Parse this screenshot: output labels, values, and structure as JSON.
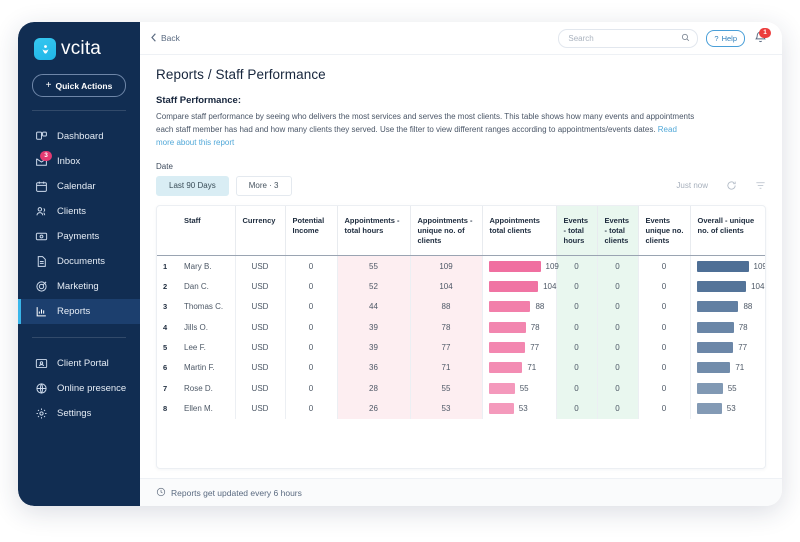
{
  "brand": {
    "name": "vcita",
    "logo_icon": "vcita-logo-icon",
    "accent": "#39b6ea",
    "sidebar_bg": "#112d52"
  },
  "sidebar": {
    "quick_actions": {
      "label": "Quick Actions",
      "icon": "plus-icon"
    },
    "items": [
      {
        "label": "Dashboard",
        "icon": "dashboard-icon",
        "active": false,
        "badge": ""
      },
      {
        "label": "Inbox",
        "icon": "inbox-icon",
        "active": false,
        "badge": "3"
      },
      {
        "label": "Calendar",
        "icon": "calendar-icon",
        "active": false,
        "badge": ""
      },
      {
        "label": "Clients",
        "icon": "clients-icon",
        "active": false,
        "badge": ""
      },
      {
        "label": "Payments",
        "icon": "payments-icon",
        "active": false,
        "badge": ""
      },
      {
        "label": "Documents",
        "icon": "documents-icon",
        "active": false,
        "badge": ""
      },
      {
        "label": "Marketing",
        "icon": "marketing-icon",
        "active": false,
        "badge": ""
      },
      {
        "label": "Reports",
        "icon": "reports-icon",
        "active": true,
        "badge": ""
      }
    ],
    "secondary_items": [
      {
        "label": "Client Portal",
        "icon": "client-portal-icon"
      },
      {
        "label": "Online presence",
        "icon": "globe-icon"
      },
      {
        "label": "Settings",
        "icon": "gear-icon"
      }
    ]
  },
  "topbar": {
    "back_label": "Back",
    "search_placeholder": "Search",
    "search_value": "",
    "help_label": "Help",
    "notifications_count": "1"
  },
  "page": {
    "title": "Reports / Staff Performance",
    "section_title": "Staff Performance:",
    "description": "Compare staff performance by seeing who delivers the most services and serves the most clients. This table shows how many events and appointments each staff member has had and how many clients they served. Use the filter to view different ranges according to appointments/events dates.",
    "read_more_label": "Read more about this report"
  },
  "filters": {
    "date_label": "Date",
    "range_chip": "Last 90 Days",
    "more_chip": "More · 3",
    "updated_label": "Just now",
    "refresh_icon": "refresh-icon",
    "filter_icon": "filter-icon"
  },
  "footer": {
    "icon": "clock-icon",
    "text": "Reports get updated every 6 hours"
  },
  "table": {
    "columns": [
      "Staff",
      "Currency",
      "Potential Income",
      "Appointments - total hours",
      "Appointments - unique no. of clients",
      "Appointments total clients",
      "Events - total hours",
      "Events - total clients",
      "Events unique no. clients",
      "Overall - unique no. of clients"
    ],
    "rows": [
      {
        "idx": "1",
        "staff": "Mary B.",
        "currency": "USD",
        "potential_income": "0",
        "appt_hours": "55",
        "appt_unique_clients": "109",
        "appt_total_clients": 109,
        "event_hours": "0",
        "event_clients": "0",
        "event_unique_clients": "0",
        "overall_unique_clients": 109
      },
      {
        "idx": "2",
        "staff": "Dan C.",
        "currency": "USD",
        "potential_income": "0",
        "appt_hours": "52",
        "appt_unique_clients": "104",
        "appt_total_clients": 104,
        "event_hours": "0",
        "event_clients": "0",
        "event_unique_clients": "0",
        "overall_unique_clients": 104
      },
      {
        "idx": "3",
        "staff": "Thomas C.",
        "currency": "USD",
        "potential_income": "0",
        "appt_hours": "44",
        "appt_unique_clients": "88",
        "appt_total_clients": 88,
        "event_hours": "0",
        "event_clients": "0",
        "event_unique_clients": "0",
        "overall_unique_clients": 88
      },
      {
        "idx": "4",
        "staff": "Jills O.",
        "currency": "USD",
        "potential_income": "0",
        "appt_hours": "39",
        "appt_unique_clients": "78",
        "appt_total_clients": 78,
        "event_hours": "0",
        "event_clients": "0",
        "event_unique_clients": "0",
        "overall_unique_clients": 78
      },
      {
        "idx": "5",
        "staff": "Lee F.",
        "currency": "USD",
        "potential_income": "0",
        "appt_hours": "39",
        "appt_unique_clients": "77",
        "appt_total_clients": 77,
        "event_hours": "0",
        "event_clients": "0",
        "event_unique_clients": "0",
        "overall_unique_clients": 77
      },
      {
        "idx": "6",
        "staff": "Martin F.",
        "currency": "USD",
        "potential_income": "0",
        "appt_hours": "36",
        "appt_unique_clients": "71",
        "appt_total_clients": 71,
        "event_hours": "0",
        "event_clients": "0",
        "event_unique_clients": "0",
        "overall_unique_clients": 71
      },
      {
        "idx": "7",
        "staff": "Rose D.",
        "currency": "USD",
        "potential_income": "0",
        "appt_hours": "28",
        "appt_unique_clients": "55",
        "appt_total_clients": 55,
        "event_hours": "0",
        "event_clients": "0",
        "event_unique_clients": "0",
        "overall_unique_clients": 55
      },
      {
        "idx": "8",
        "staff": "Ellen M.",
        "currency": "USD",
        "potential_income": "0",
        "appt_hours": "26",
        "appt_unique_clients": "53",
        "appt_total_clients": 53,
        "event_hours": "0",
        "event_clients": "0",
        "event_unique_clients": "0",
        "overall_unique_clients": 53
      }
    ],
    "bar_max": 109,
    "pink_bar_color": "#f06fa0",
    "blue_bar_color": "#4e6f96"
  }
}
